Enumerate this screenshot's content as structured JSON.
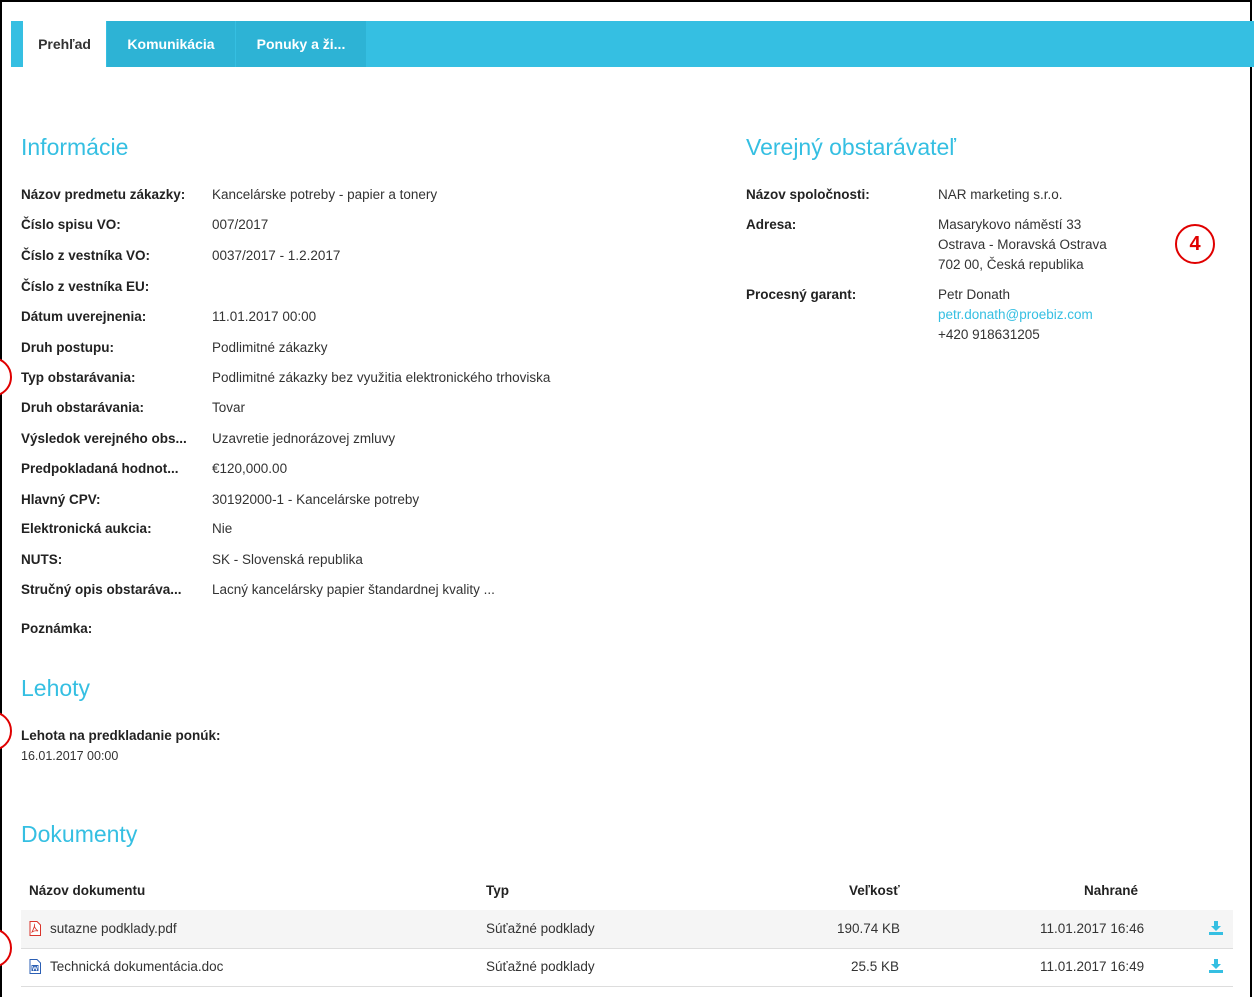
{
  "tabs": [
    {
      "label": "Prehľad"
    },
    {
      "label": "Komunikácia"
    },
    {
      "label": "Ponuky a ži..."
    }
  ],
  "info": {
    "title": "Informácie",
    "rows": [
      {
        "label": "Názov predmetu zákazky:",
        "value": "Kancelárske potreby - papier a tonery"
      },
      {
        "label": "Číslo spisu VO:",
        "value": "007/2017"
      },
      {
        "label": "Číslo z vestníka VO:",
        "value": "0037/2017 - 1.2.2017"
      },
      {
        "label": "Číslo z vestníka EU:",
        "value": ""
      },
      {
        "label": "Dátum uverejnenia:",
        "value": "11.01.2017 00:00"
      },
      {
        "label": "Druh postupu:",
        "value": "Podlimitné zákazky"
      },
      {
        "label": "Typ obstarávania:",
        "value": "Podlimitné zákazky bez využitia elektronického trhoviska"
      },
      {
        "label": "Druh obstarávania:",
        "value": "Tovar"
      },
      {
        "label": "Výsledok verejného obs...",
        "value": "Uzavretie jednorázovej zmluvy"
      },
      {
        "label": "Predpokladaná hodnot...",
        "value": "€120,000.00"
      },
      {
        "label": "Hlavný CPV:",
        "value": "30192000-1 - Kancelárske potreby"
      },
      {
        "label": "Elektronická aukcia:",
        "value": "Nie"
      },
      {
        "label": "NUTS:",
        "value": "SK - Slovenská republika"
      },
      {
        "label": "Stručný opis obstaráva...",
        "value": "Lacný kancelársky papier štandardnej kvality ..."
      }
    ],
    "note_label": "Poznámka:"
  },
  "buyer": {
    "title": "Verejný obstarávateľ",
    "company_label": "Názov spoločnosti:",
    "company_value": "NAR marketing s.r.o.",
    "address_label": "Adresa:",
    "address_lines": [
      "Masarykovo náměstí 33",
      "Ostrava - Moravská Ostrava",
      "702 00, Česká republika"
    ],
    "guarantor_label": "Procesný garant:",
    "guarantor_name": "Petr Donath",
    "guarantor_email": "petr.donath@proebiz.com",
    "guarantor_phone": "+420 918631205"
  },
  "annotation": {
    "number": "4"
  },
  "deadlines": {
    "title": "Lehoty",
    "label": "Lehota na predkladanie ponúk:",
    "value": "16.01.2017 00:00"
  },
  "documents": {
    "title": "Dokumenty",
    "headers": {
      "name": "Názov dokumentu",
      "type": "Typ",
      "size": "Veľkosť",
      "uploaded": "Nahrané"
    },
    "rows": [
      {
        "name": "sutazne podklady.pdf",
        "type": "Súťažné podklady",
        "size": "190.74 KB",
        "uploaded": "11.01.2017 16:46",
        "icon": "pdf-file-icon"
      },
      {
        "name": "Technická dokumentácia.doc",
        "type": "Súťažné podklady",
        "size": "25.5 KB",
        "uploaded": "11.01.2017 16:49",
        "icon": "word-file-icon"
      }
    ]
  },
  "colors": {
    "accent": "#35bfe2",
    "annotation": "#e00000"
  }
}
